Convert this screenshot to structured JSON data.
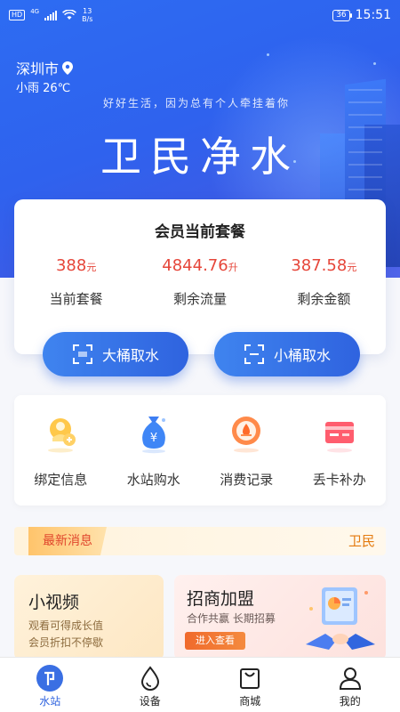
{
  "status_bar": {
    "hd": "HD",
    "network": "4G",
    "speed_value": "13",
    "speed_unit": "B/s",
    "battery": "36",
    "time": "15:51"
  },
  "header": {
    "city": "深圳市",
    "weather": "小雨 26℃",
    "slogan": "好好生活，因为总有个人牵挂着你",
    "brand": "卫民净水"
  },
  "member": {
    "title": "会员当前套餐",
    "stats": [
      {
        "value": "388",
        "unit": "元",
        "label": "当前套餐"
      },
      {
        "value": "4844.76",
        "unit": "升",
        "label": "剩余流量"
      },
      {
        "value": "387.58",
        "unit": "元",
        "label": "剩余金额"
      }
    ],
    "big_bucket_label": "大桶取水",
    "small_bucket_label": "小桶取水"
  },
  "services": [
    {
      "label": "绑定信息",
      "icon": "bind-info-icon"
    },
    {
      "label": "水站购水",
      "icon": "money-bag-icon"
    },
    {
      "label": "消费记录",
      "icon": "consumption-record-icon"
    },
    {
      "label": "丢卡补办",
      "icon": "card-replace-icon"
    }
  ],
  "news": {
    "tag": "最新消息",
    "text": "卫民"
  },
  "promos": {
    "video": {
      "title": "小视频",
      "line1": "观看可得成长值",
      "line2": "会员折扣不停歇"
    },
    "join": {
      "title": "招商加盟",
      "subtitle": "合作共赢  长期招募",
      "button": "进入查看"
    }
  },
  "tabs": [
    {
      "label": "水站",
      "icon": "station-icon",
      "active": true
    },
    {
      "label": "设备",
      "icon": "water-drop-icon",
      "active": false
    },
    {
      "label": "商城",
      "icon": "shopping-bag-icon",
      "active": false
    },
    {
      "label": "我的",
      "icon": "profile-icon",
      "active": false
    }
  ],
  "colors": {
    "primary": "#2f63df",
    "accent_red": "#e6463a",
    "news_orange": "#e47b10"
  }
}
